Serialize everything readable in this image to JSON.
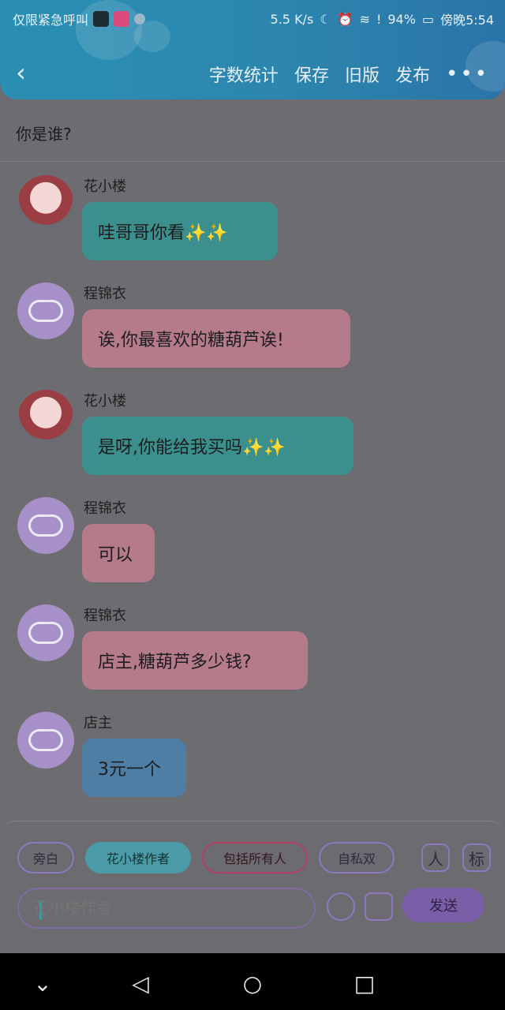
{
  "status_bar": {
    "left_text": "仅限紧急呼叫",
    "network_speed": "5.5 K/s",
    "battery": "94%",
    "time": "傍晚5:54"
  },
  "header": {
    "actions": [
      "字数统计",
      "保存",
      "旧版",
      "发布"
    ],
    "more": "•••"
  },
  "page_title": "你是谁?",
  "messages": [
    {
      "name": "花小楼",
      "text": "哇哥哥你看✨✨",
      "bubble": "teal",
      "avatar": "girl"
    },
    {
      "name": "程锦衣",
      "text": "诶,你最喜欢的糖葫芦诶!",
      "bubble": "pink",
      "avatar": "bubble"
    },
    {
      "name": "花小楼",
      "text": "是呀,你能给我买吗✨✨",
      "bubble": "teal",
      "avatar": "girl"
    },
    {
      "name": "程锦衣",
      "text": "可以",
      "bubble": "pink",
      "avatar": "bubble"
    },
    {
      "name": "程锦衣",
      "text": "店主,糖葫芦多少钱?",
      "bubble": "pink",
      "avatar": "bubble"
    },
    {
      "name": "店主",
      "text": "3元一个",
      "bubble": "blue",
      "avatar": "bubble"
    }
  ],
  "composer": {
    "chips": [
      "旁白",
      "花小楼作者",
      "包括所有人",
      "自私双"
    ],
    "btn_user": "人",
    "btn_tag": "标",
    "input_placeholder": "花小楼作者:",
    "send_label": "发送"
  },
  "colors": {
    "header": "#2a8fb3",
    "teal_bubble": "#3b8f8c",
    "pink_bubble": "#b57b8a",
    "blue_bubble": "#4f7ea4",
    "accent_purple": "#7a5ea8"
  }
}
